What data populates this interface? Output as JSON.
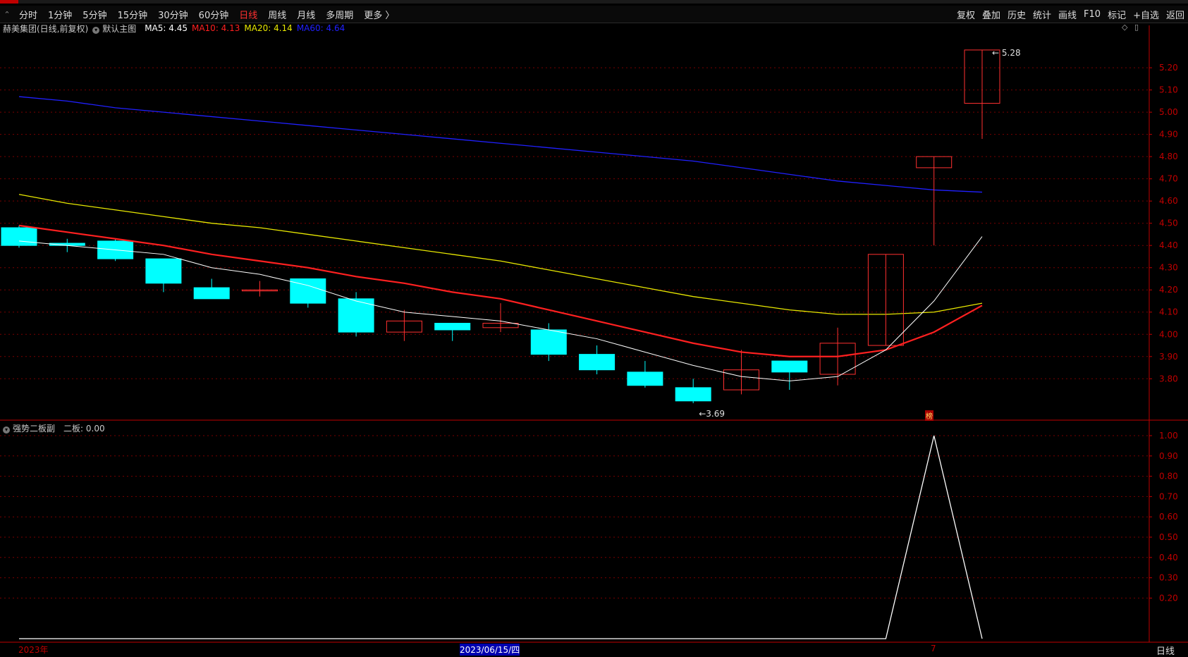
{
  "toolbar": {
    "back_label": "⌃",
    "periods": [
      "分时",
      "1分钟",
      "5分钟",
      "15分钟",
      "30分钟",
      "60分钟",
      "日线",
      "周线",
      "月线",
      "多周期",
      "更多 〉"
    ],
    "active_period": "日线",
    "right_buttons": [
      "复权",
      "叠加",
      "历史",
      "统计",
      "画线",
      "F10",
      "标记",
      "+自选",
      "返回"
    ]
  },
  "main_pane": {
    "title": "赫美集团(日线,前复权)",
    "indicator_name": "默认主图",
    "ma_legend": [
      {
        "label": "MA5: 4.45",
        "color": "#ffffff"
      },
      {
        "label": "MA10: 4.13",
        "color": "#ff2020"
      },
      {
        "label": "MA20: 4.14",
        "color": "#e8e800"
      },
      {
        "label": "MA60: 4.64",
        "color": "#2020ff"
      }
    ],
    "price_labels": [
      "5.20",
      "5.10",
      "5.00",
      "4.90",
      "4.80",
      "4.70",
      "4.60",
      "4.50",
      "4.40",
      "4.30",
      "4.20",
      "4.10",
      "4.00",
      "3.90",
      "3.80"
    ],
    "high_marker": "5.28",
    "low_marker": "3.69",
    "badge": "榜"
  },
  "sub_pane": {
    "indicator_name": "强势二板副",
    "value_label": "二板: 0.00",
    "scale_labels": [
      "1.00",
      "0.90",
      "0.80",
      "0.70",
      "0.60",
      "0.50",
      "0.40",
      "0.30",
      "0.20"
    ]
  },
  "date_axis": {
    "left_label": "2023年",
    "highlight_label": "2023/06/15/四",
    "mark_label": "7",
    "period_label": "日线"
  },
  "colors": {
    "up": "#ff3030",
    "down": "#00ffff",
    "grid": "#7a0000",
    "axis": "#c00000"
  },
  "chart_data": {
    "type": "candlestick",
    "ylim": [
      3.62,
      5.34
    ],
    "candles": [
      {
        "o": 4.48,
        "h": 4.49,
        "l": 4.39,
        "c": 4.4
      },
      {
        "o": 4.41,
        "h": 4.43,
        "l": 4.37,
        "c": 4.4
      },
      {
        "o": 4.42,
        "h": 4.43,
        "l": 4.33,
        "c": 4.34
      },
      {
        "o": 4.34,
        "h": 4.34,
        "l": 4.19,
        "c": 4.23
      },
      {
        "o": 4.21,
        "h": 4.25,
        "l": 4.16,
        "c": 4.16
      },
      {
        "o": 4.2,
        "h": 4.24,
        "l": 4.17,
        "c": 4.2
      },
      {
        "o": 4.25,
        "h": 4.25,
        "l": 4.12,
        "c": 4.14
      },
      {
        "o": 4.16,
        "h": 4.19,
        "l": 3.99,
        "c": 4.01
      },
      {
        "o": 4.01,
        "h": 4.11,
        "l": 3.97,
        "c": 4.06
      },
      {
        "o": 4.05,
        "h": 4.05,
        "l": 3.97,
        "c": 4.02
      },
      {
        "o": 4.03,
        "h": 4.14,
        "l": 4.01,
        "c": 4.05
      },
      {
        "o": 4.02,
        "h": 4.05,
        "l": 3.88,
        "c": 3.91
      },
      {
        "o": 3.91,
        "h": 3.95,
        "l": 3.82,
        "c": 3.84
      },
      {
        "o": 3.83,
        "h": 3.88,
        "l": 3.76,
        "c": 3.77
      },
      {
        "o": 3.76,
        "h": 3.8,
        "l": 3.69,
        "c": 3.7
      },
      {
        "o": 3.75,
        "h": 3.93,
        "l": 3.73,
        "c": 3.84
      },
      {
        "o": 3.88,
        "h": 3.88,
        "l": 3.75,
        "c": 3.83
      },
      {
        "o": 3.82,
        "h": 4.03,
        "l": 3.77,
        "c": 3.96
      },
      {
        "o": 3.95,
        "h": 4.36,
        "l": 3.95,
        "c": 4.36
      },
      {
        "o": 4.75,
        "h": 4.8,
        "l": 4.4,
        "c": 4.8
      },
      {
        "o": 5.04,
        "h": 5.28,
        "l": 4.88,
        "c": 5.28
      }
    ],
    "ma5": [
      4.42,
      4.4,
      4.38,
      4.36,
      4.3,
      4.27,
      4.22,
      4.15,
      4.1,
      4.08,
      4.06,
      4.02,
      3.98,
      3.92,
      3.86,
      3.81,
      3.79,
      3.81,
      3.93,
      4.15,
      4.44
    ],
    "ma10": [
      4.49,
      4.46,
      4.43,
      4.4,
      4.36,
      4.33,
      4.3,
      4.26,
      4.23,
      4.19,
      4.16,
      4.11,
      4.06,
      4.01,
      3.96,
      3.92,
      3.9,
      3.9,
      3.93,
      4.01,
      4.13
    ],
    "ma20": [
      4.63,
      4.59,
      4.56,
      4.53,
      4.5,
      4.48,
      4.45,
      4.42,
      4.39,
      4.36,
      4.33,
      4.29,
      4.25,
      4.21,
      4.17,
      4.14,
      4.11,
      4.09,
      4.09,
      4.1,
      4.14
    ],
    "ma60": [
      5.07,
      5.05,
      5.02,
      5.0,
      4.98,
      4.96,
      4.94,
      4.92,
      4.9,
      4.88,
      4.86,
      4.84,
      4.82,
      4.8,
      4.78,
      4.75,
      4.72,
      4.69,
      4.67,
      4.65,
      4.64
    ],
    "sub_series": [
      0,
      0,
      0,
      0,
      0,
      0,
      0,
      0,
      0,
      0,
      0,
      0,
      0,
      0,
      0,
      0,
      0,
      0,
      0,
      1,
      0
    ],
    "sub_ylim": [
      0,
      1.0
    ]
  }
}
